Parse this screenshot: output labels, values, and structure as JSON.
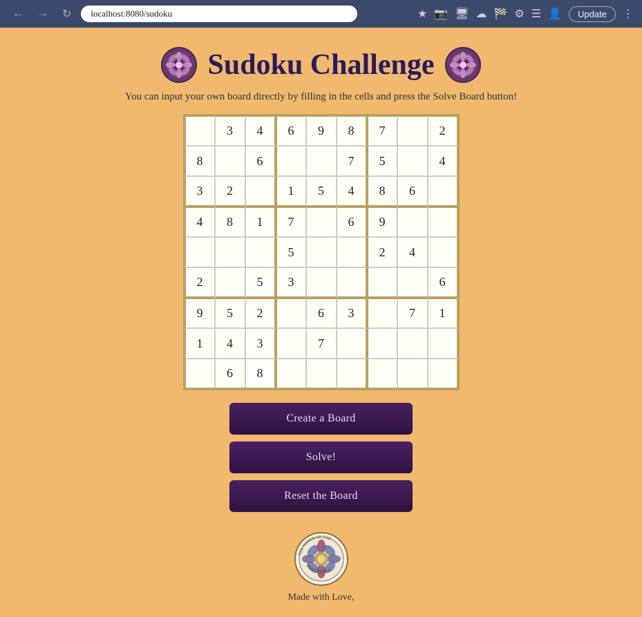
{
  "browser": {
    "url": "localhost:8080/sudoku",
    "update_label": "Update"
  },
  "page": {
    "title": "Sudoku Challenge",
    "subtitle": "You can input your own board directly by filling in the cells and press the Solve Board button!",
    "logo_alt": "decorative mandala icon"
  },
  "buttons": {
    "create": "Create a Board",
    "solve": "Solve!",
    "reset": "Reset the Board"
  },
  "footer": {
    "text": "Made with Love,"
  },
  "grid": {
    "cells": [
      [
        "",
        "3",
        "4",
        "6",
        "9",
        "8",
        "7",
        "",
        "2"
      ],
      [
        "8",
        "",
        "6",
        "",
        "",
        "7",
        "5",
        "",
        "4"
      ],
      [
        "3",
        "2",
        "",
        "1",
        "5",
        "4",
        "8",
        "6",
        ""
      ],
      [
        "4",
        "8",
        "1",
        "7",
        "",
        "6",
        "9",
        "",
        ""
      ],
      [
        "",
        "",
        "",
        "5",
        "",
        "",
        "2",
        "4",
        ""
      ],
      [
        "2",
        "",
        "5",
        "3",
        "",
        "",
        "",
        "",
        "6"
      ],
      [
        "9",
        "5",
        "2",
        "",
        "6",
        "3",
        "",
        "7",
        "1"
      ],
      [
        "1",
        "4",
        "3",
        "",
        "7",
        "",
        "",
        "",
        ""
      ],
      [
        "",
        "6",
        "8",
        "|",
        "",
        "",
        "",
        "",
        ""
      ]
    ]
  }
}
